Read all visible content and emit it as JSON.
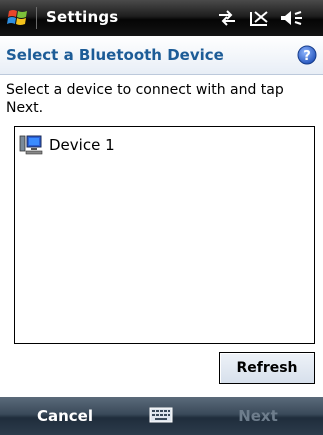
{
  "titlebar": {
    "title": "Settings",
    "icons": [
      "windows-start-icon",
      "sync-arrows-icon",
      "no-signal-icon",
      "speaker-icon"
    ]
  },
  "header": {
    "title": "Select a Bluetooth Device",
    "help_icon": "help-icon"
  },
  "instructions": "Select a device to connect with and tap Next.",
  "device_list": {
    "items": [
      {
        "label": "Device 1",
        "icon": "computer-icon"
      }
    ]
  },
  "buttons": {
    "refresh": "Refresh"
  },
  "softkeys": {
    "left": "Cancel",
    "right": "Next",
    "right_enabled": false,
    "center_icon": "keyboard-icon"
  },
  "colors": {
    "header_title": "#1d5c97",
    "softkey_disabled": "#6e7d8c",
    "titlebar": "#141414"
  }
}
